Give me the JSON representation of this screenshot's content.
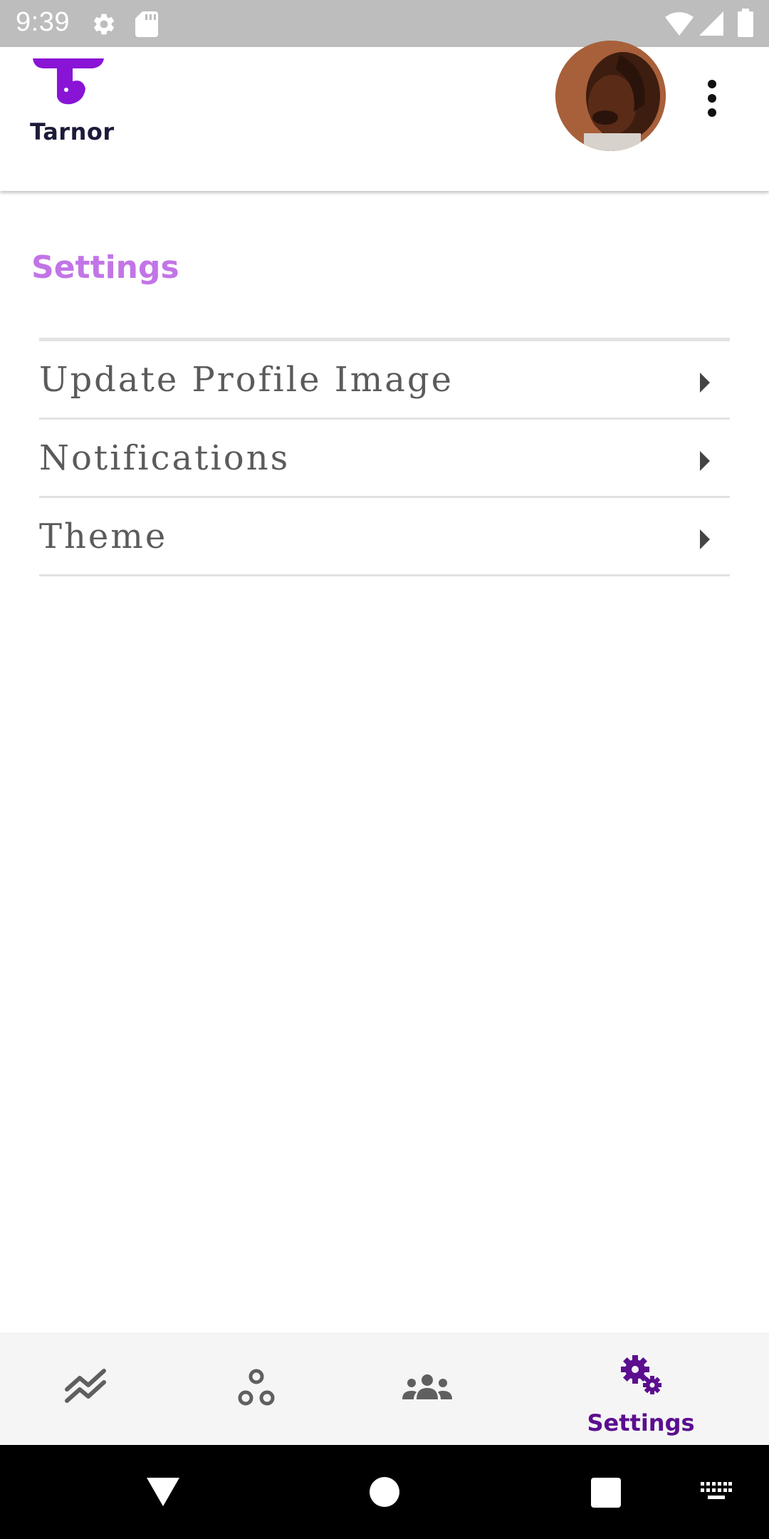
{
  "status_bar": {
    "time": "9:39",
    "icons": [
      "settings-icon",
      "sd-card-icon",
      "wifi-icon",
      "signal-icon",
      "battery-icon"
    ]
  },
  "app_bar": {
    "brand": "Tarnor",
    "brand_color": "#8a14d6",
    "profile_avatar": "user-avatar",
    "overflow_menu": "more-vert-icon"
  },
  "page": {
    "title": "Settings",
    "title_color": "#c275e6"
  },
  "settings_items": [
    {
      "label": "Update Profile Image",
      "icon": "arrow-right-icon"
    },
    {
      "label": "Notifications",
      "icon": "arrow-right-icon"
    },
    {
      "label": "Theme",
      "icon": "arrow-right-icon"
    }
  ],
  "bottom_nav": {
    "active_color": "#5b0e8f",
    "inactive_color": "#5f5f5f",
    "items": [
      {
        "icon": "trending-chart-icon",
        "label": "",
        "active": false
      },
      {
        "icon": "circles-icon",
        "label": "",
        "active": false
      },
      {
        "icon": "group-icon",
        "label": "",
        "active": false
      },
      {
        "icon": "cogs-icon",
        "label": "Settings",
        "active": true
      }
    ]
  },
  "system_nav": {
    "icons": [
      "back-icon",
      "home-icon",
      "recents-icon",
      "keyboard-icon"
    ]
  }
}
